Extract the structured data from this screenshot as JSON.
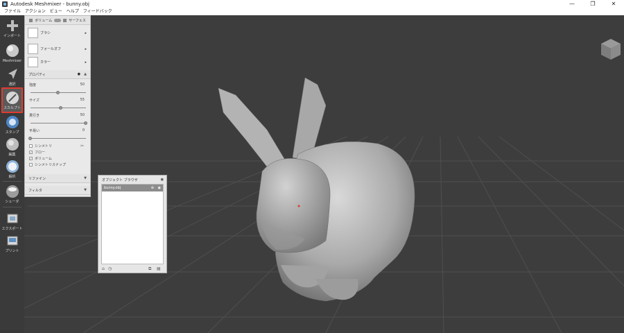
{
  "window": {
    "title": "Autodesk Meshmixer - bunny.obj",
    "buttons": [
      "—",
      "❐",
      "✕"
    ]
  },
  "menu": [
    "ファイル",
    "アクション",
    "ビュー",
    "ヘルプ",
    "フィードバック"
  ],
  "toolbar": [
    {
      "label": "インポート",
      "icon": "plus-icon"
    },
    {
      "label": "Meshmixer",
      "icon": "meshmixer-sphere-icon"
    },
    {
      "label": "選択",
      "icon": "select-arrow-icon"
    },
    {
      "label": "スカルプト",
      "icon": "sculpt-brush-icon",
      "active": true
    },
    {
      "label": "スタンプ",
      "icon": "stamp-icon"
    },
    {
      "label": "編集",
      "icon": "edit-icon"
    },
    {
      "label": "解析",
      "icon": "analysis-icon"
    },
    {
      "label": "シェーダ",
      "icon": "shader-sphere-icon"
    },
    {
      "label": "エクスポート",
      "icon": "export-icon"
    },
    {
      "label": "プリント",
      "icon": "print-icon"
    }
  ],
  "sculpt_panel": {
    "mode_volume": "ボリューム",
    "mode_surface": "サーフェス",
    "brush": "ブラシ",
    "falloff": "フォールオフ",
    "color": "カラー",
    "properties": "プロパティ",
    "strength": {
      "label": "強度",
      "value": "50",
      "level": 0.5
    },
    "size": {
      "label": "サイズ",
      "value": "55",
      "level": 0.55
    },
    "depth": {
      "label": "貫行き",
      "value": "50",
      "level": 1.0
    },
    "lazy": {
      "label": "平易い",
      "value": "0",
      "level": 0.0
    },
    "symmetry": {
      "label": "シンメトリ",
      "checked": false
    },
    "flow": {
      "label": "フロー",
      "checked": true
    },
    "volume": {
      "label": "ボリューム",
      "checked": true
    },
    "symmetry_snap": {
      "label": "シンメトリスナップ",
      "checked": false
    },
    "refine": "リファイン",
    "filter": "フィルタ"
  },
  "object_browser": {
    "title": "オブジェクト ブラウザ",
    "items": [
      "bunny.obj"
    ]
  },
  "colors": {
    "viewport_bg": "#3d3d3d",
    "active_tool_border": "#e23b2e",
    "selected_row": "#8c8c8c"
  }
}
